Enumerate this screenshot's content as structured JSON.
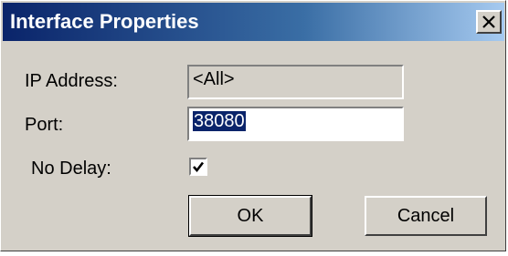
{
  "window": {
    "title": "Interface Properties",
    "close_icon": "close-icon"
  },
  "form": {
    "ip_label": "IP Address:",
    "ip_value": "<All>",
    "port_label": "Port:",
    "port_value": "38080",
    "no_delay_label": "No Delay:",
    "no_delay_checked": true
  },
  "buttons": {
    "ok_label": "OK",
    "cancel_label": "Cancel"
  },
  "colors": {
    "titlebar_start": "#0a246a",
    "titlebar_end": "#a6caf0",
    "dialog_face": "#d4d0c8",
    "selection": "#0a246a"
  }
}
